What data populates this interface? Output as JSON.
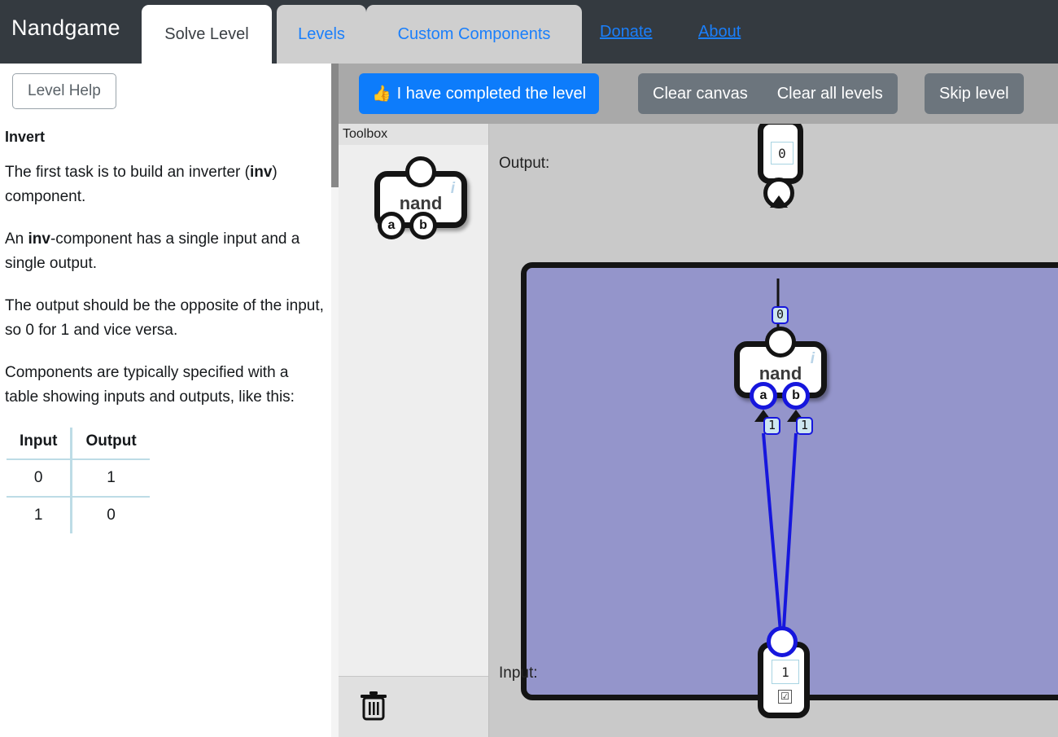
{
  "navbar": {
    "brand": "Nandgame",
    "tabs": [
      {
        "label": "Solve Level",
        "active": true
      },
      {
        "label": "Levels",
        "active": false
      },
      {
        "label": "Custom Components",
        "active": false
      }
    ],
    "links": [
      {
        "label": "Donate"
      },
      {
        "label": "About"
      }
    ],
    "colors": {
      "background": "#343a40",
      "link": "#1a7ffb",
      "active_tab_bg": "#ffffff",
      "inactive_tab_bg": "#cfcfcf"
    }
  },
  "sidebar": {
    "help_button": "Level Help",
    "title": "Invert",
    "paragraphs": [
      "The first task is to build an inverter (inv) component.",
      "An inv-component has a single input and a single output.",
      "The output should be the opposite of the input, so 0 for 1 and vice versa.",
      "Components are typically specified with a table showing inputs and outputs, like this:"
    ],
    "truth_table": {
      "headers": [
        "Input",
        "Output"
      ],
      "rows": [
        [
          "0",
          "1"
        ],
        [
          "1",
          "0"
        ]
      ],
      "border_color": "#bddce6"
    }
  },
  "toolbar": {
    "complete_label": "I have completed the level",
    "thumbsup_icon": "👍",
    "clear_canvas_label": "Clear canvas",
    "clear_all_levels_label": "Clear all levels",
    "skip_level_label": "Skip level",
    "colors": {
      "primary": "#0d7cfb",
      "secondary": "#6c757d",
      "strip_bg": "#a9a9a9"
    }
  },
  "toolbox": {
    "header": "Toolbox",
    "trash_icon": "trash-icon",
    "component": {
      "name": "nand",
      "info_icon": "i",
      "inputs": [
        "a",
        "b"
      ]
    }
  },
  "canvas": {
    "output_label": "Output:",
    "input_label": "Input:",
    "region_color": "#9495cb",
    "background_color": "#c9c9c9",
    "output_node": {
      "value": "0"
    },
    "input_node": {
      "value": "1",
      "checkbox": "☑"
    },
    "gate": {
      "name": "nand",
      "info_icon": "i",
      "inputs": [
        "a",
        "b"
      ]
    },
    "wire_values": {
      "gate_output": "0",
      "input_a": "1",
      "input_b": "1"
    },
    "wire_colors": {
      "low": "#141414",
      "high": "#1616dd"
    }
  }
}
